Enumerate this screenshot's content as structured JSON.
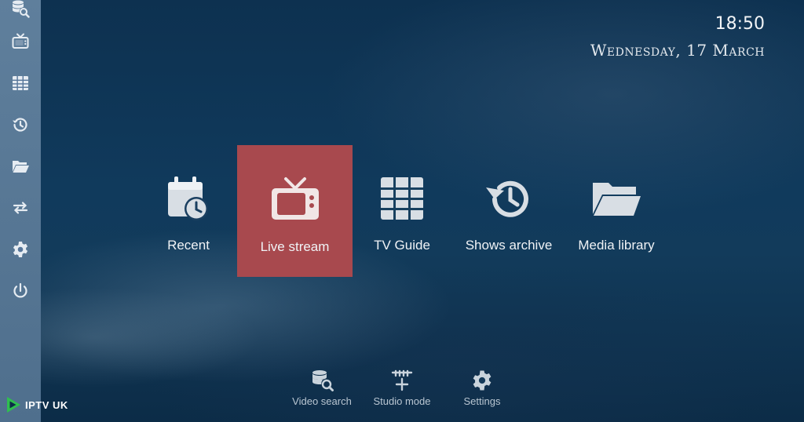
{
  "status": {
    "time": "18:50",
    "date": "Wednesday, 17 March"
  },
  "sidebar": {
    "items": [
      {
        "icon": "video-search-icon"
      },
      {
        "icon": "tv-icon"
      },
      {
        "icon": "grid-icon"
      },
      {
        "icon": "history-icon"
      },
      {
        "icon": "folder-icon"
      },
      {
        "icon": "switch-icon"
      },
      {
        "icon": "gear-icon"
      },
      {
        "icon": "power-icon"
      }
    ]
  },
  "main_menu": {
    "items": [
      {
        "label": "Recent",
        "icon": "calendar-clock-icon"
      },
      {
        "label": "Live stream",
        "icon": "tv-icon",
        "selected": true
      },
      {
        "label": "TV Guide",
        "icon": "grid-icon"
      },
      {
        "label": "Shows archive",
        "icon": "history-icon"
      },
      {
        "label": "Media library",
        "icon": "folder-icon"
      }
    ]
  },
  "bottom_bar": {
    "items": [
      {
        "label": "Video search",
        "icon": "video-search-icon"
      },
      {
        "label": "Studio mode",
        "icon": "studio-mode-icon"
      },
      {
        "label": "Settings",
        "icon": "gear-icon"
      }
    ]
  },
  "watermark": {
    "text": "IPTV UK"
  },
  "colors": {
    "sidebar": "#5a7a97",
    "selected_tile": "#a8494e",
    "background": "#0e3352"
  }
}
